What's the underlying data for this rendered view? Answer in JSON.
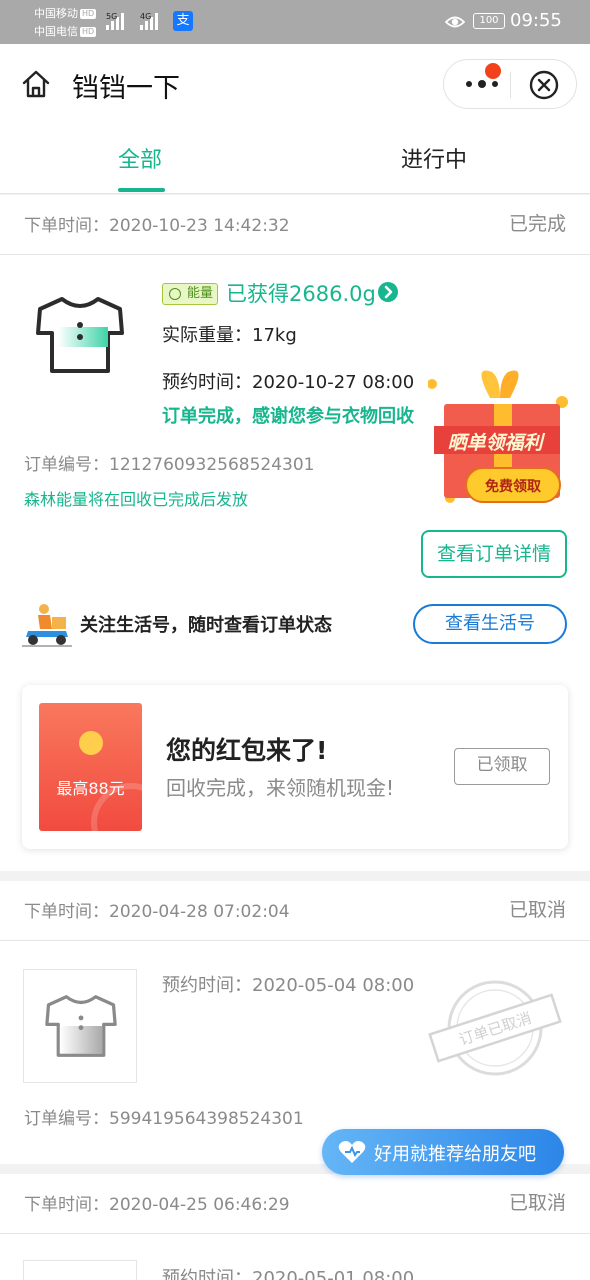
{
  "status_bar": {
    "carrier1": "中国移动",
    "carrier2": "中国电信",
    "hd": "HD",
    "net1": "5G",
    "net2": "4G",
    "pay_glyph": "支",
    "battery": "100",
    "time": "09:55"
  },
  "navbar": {
    "title": "铛铛一下",
    "home_icon": "home-icon",
    "more_icon": "more-dots-icon",
    "close_icon": "close-circle-icon"
  },
  "tabs": [
    {
      "label": "全部",
      "active": true
    },
    {
      "label": "进行中",
      "active": false
    }
  ],
  "orders": [
    {
      "order_time_label": "下单时间：",
      "order_time": "2020-10-23 14:42:32",
      "status": "已完成",
      "energy_badge": "能量",
      "energy_text": "已获得2686.0g",
      "weight_label": "实际重量：",
      "weight": "17kg",
      "reserve_label": "预约时间：",
      "reserve_time": "2020-10-27 08:00",
      "message": "订单完成，感谢您参与衣物回收",
      "order_no_label": "订单编号：",
      "order_no": "1212760932568524301",
      "energy_note": "森林能量将在回收已完成后发放",
      "detail_button": "查看订单详情",
      "follow_text": "关注生活号，随时查看订单状态",
      "follow_button": "查看生活号",
      "gift_banner": {
        "title": "晒单领福利",
        "button": "免费领取"
      },
      "red_packet": {
        "amount": "最高88元",
        "title": "您的红包来了!",
        "subtitle": "回收完成，来领随机现金!",
        "button": "已领取"
      }
    },
    {
      "order_time_label": "下单时间：",
      "order_time": "2020-04-28 07:02:04",
      "status": "已取消",
      "reserve_label": "预约时间：",
      "reserve_time": "2020-05-04 08:00",
      "order_no_label": "订单编号：",
      "order_no": "599419564398524301",
      "stamp_text": "订单已取消"
    },
    {
      "order_time_label": "下单时间：",
      "order_time": "2020-04-25 06:46:29",
      "status": "已取消",
      "reserve_label": "预约时间：",
      "reserve_time": "2020-05-01 08:00"
    }
  ],
  "recommend_button": "好用就推荐给朋友吧",
  "colors": {
    "accent_green": "#17b68e",
    "blue": "#1a7bd6",
    "red_dot": "#f2421b",
    "gift_red": "#f14b3f"
  }
}
